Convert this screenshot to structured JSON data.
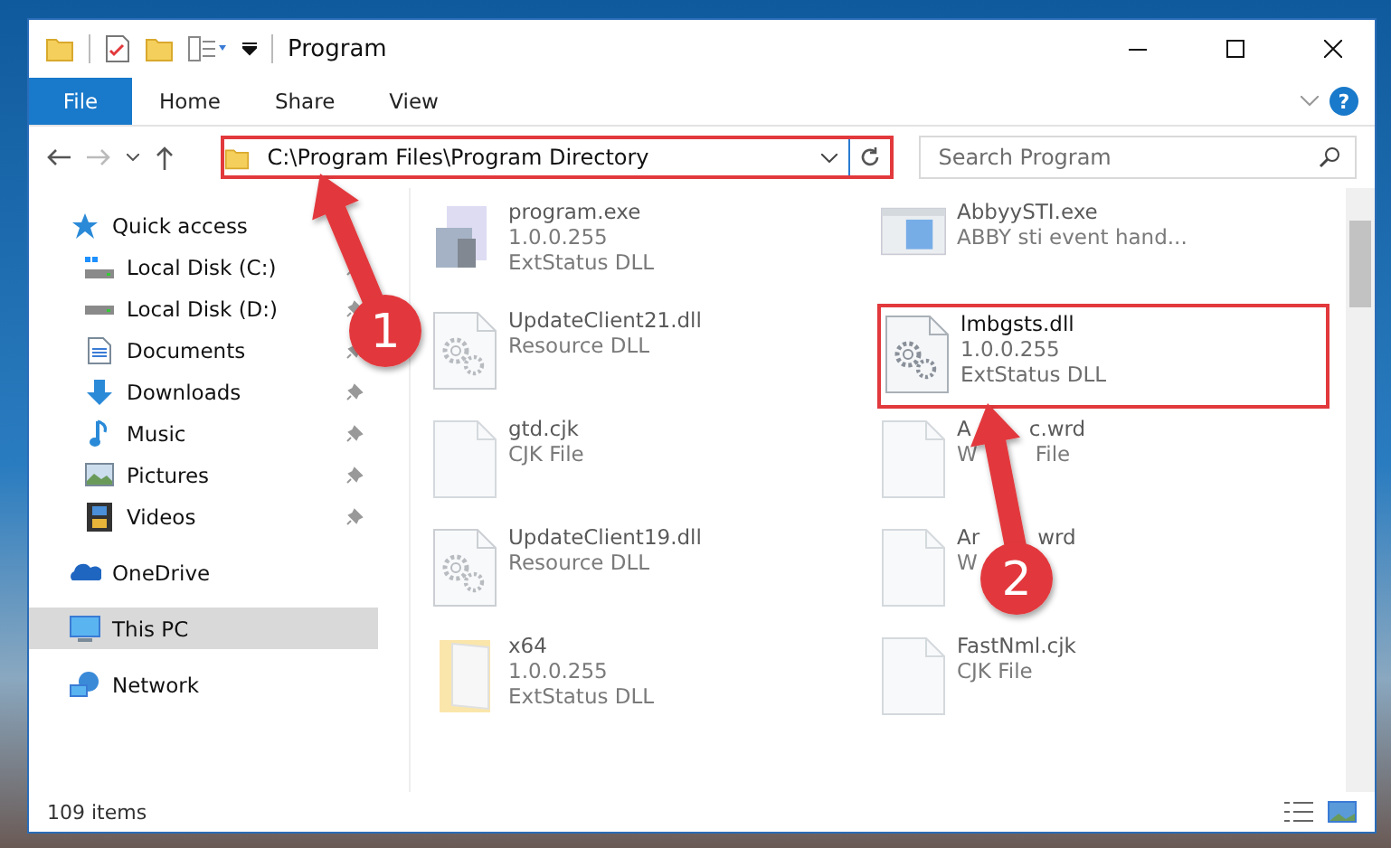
{
  "window": {
    "title": "Program"
  },
  "ribbon": {
    "tabs": [
      {
        "label": "File",
        "selected": true
      },
      {
        "label": "Home",
        "selected": false
      },
      {
        "label": "Share",
        "selected": false
      },
      {
        "label": "View",
        "selected": false
      }
    ],
    "help": "?"
  },
  "address": {
    "path": "C:\\Program Files\\Program Directory",
    "highlighted": true
  },
  "search": {
    "placeholder": "Search Program"
  },
  "sidebar": {
    "items": [
      {
        "label": "Quick access",
        "kind": "star",
        "selected": false,
        "children": [
          {
            "label": "Local Disk (C:)",
            "kind": "system-drive",
            "pinned": true,
            "selected": false
          },
          {
            "label": "Local Disk (D:)",
            "kind": "drive",
            "pinned": true,
            "selected": false
          },
          {
            "label": "Documents",
            "kind": "documents",
            "pinned": true,
            "selected": false
          },
          {
            "label": "Downloads",
            "kind": "downloads",
            "pinned": true,
            "selected": false
          },
          {
            "label": "Music",
            "kind": "music",
            "pinned": true,
            "selected": false
          },
          {
            "label": "Pictures",
            "kind": "pictures",
            "pinned": true,
            "selected": false
          },
          {
            "label": "Videos",
            "kind": "videos",
            "pinned": true,
            "selected": false
          }
        ]
      },
      {
        "label": "OneDrive",
        "kind": "cloud",
        "selected": false
      },
      {
        "label": "This PC",
        "kind": "pc",
        "selected": true
      },
      {
        "label": "Network",
        "kind": "network",
        "selected": false
      }
    ]
  },
  "files": [
    {
      "name": "program.exe",
      "details": [
        "1.0.0.255",
        "ExtStatus DLL"
      ],
      "kind": "exe",
      "blurred": true,
      "highlighted": false
    },
    {
      "name": "AbbyySTI.exe",
      "details": [
        "ABBY sti event hand..."
      ],
      "kind": "app",
      "blurred": true,
      "highlighted": false
    },
    {
      "name": "UpdateClient21.dll",
      "details": [
        "Resource DLL"
      ],
      "kind": "dll",
      "blurred": true,
      "highlighted": false
    },
    {
      "name": "lmbgsts.dll",
      "details": [
        "1.0.0.255",
        "ExtStatus DLL"
      ],
      "kind": "dll",
      "blurred": false,
      "highlighted": true
    },
    {
      "name": "gtd.cjk",
      "details": [
        "CJK File"
      ],
      "kind": "file",
      "blurred": true,
      "highlighted": false
    },
    {
      "name": [
        "A",
        "c.wrd"
      ],
      "details": [
        [
          "W",
          "File"
        ]
      ],
      "kind": "file",
      "blurred": true,
      "highlighted": false
    },
    {
      "name": "UpdateClient19.dll",
      "details": [
        "Resource DLL"
      ],
      "kind": "dll",
      "blurred": true,
      "highlighted": false
    },
    {
      "name": [
        "Ar",
        "wrd"
      ],
      "details": [
        [
          "W"
        ]
      ],
      "kind": "file",
      "blurred": true,
      "highlighted": false
    },
    {
      "name": "x64",
      "details": [
        "1.0.0.255",
        "ExtStatus DLL"
      ],
      "kind": "folder",
      "blurred": true,
      "highlighted": false
    },
    {
      "name": "FastNml.cjk",
      "details": [
        "CJK File"
      ],
      "kind": "file",
      "blurred": true,
      "highlighted": false
    }
  ],
  "status_bar": {
    "count": "109 items"
  },
  "annotations": [
    {
      "label": "1"
    },
    {
      "label": "2"
    }
  ]
}
